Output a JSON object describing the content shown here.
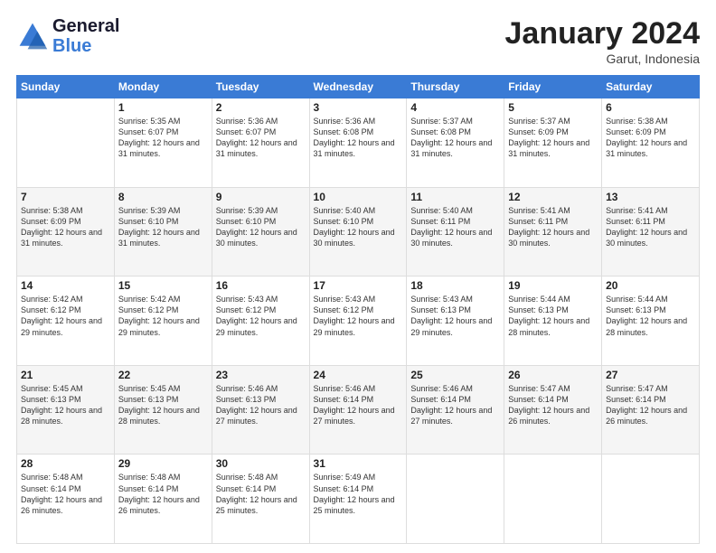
{
  "header": {
    "logo_line1": "General",
    "logo_line2": "Blue",
    "month": "January 2024",
    "location": "Garut, Indonesia"
  },
  "days": [
    "Sunday",
    "Monday",
    "Tuesday",
    "Wednesday",
    "Thursday",
    "Friday",
    "Saturday"
  ],
  "weeks": [
    [
      {
        "num": "",
        "sunrise": "",
        "sunset": "",
        "daylight": ""
      },
      {
        "num": "1",
        "sunrise": "Sunrise: 5:35 AM",
        "sunset": "Sunset: 6:07 PM",
        "daylight": "Daylight: 12 hours and 31 minutes."
      },
      {
        "num": "2",
        "sunrise": "Sunrise: 5:36 AM",
        "sunset": "Sunset: 6:07 PM",
        "daylight": "Daylight: 12 hours and 31 minutes."
      },
      {
        "num": "3",
        "sunrise": "Sunrise: 5:36 AM",
        "sunset": "Sunset: 6:08 PM",
        "daylight": "Daylight: 12 hours and 31 minutes."
      },
      {
        "num": "4",
        "sunrise": "Sunrise: 5:37 AM",
        "sunset": "Sunset: 6:08 PM",
        "daylight": "Daylight: 12 hours and 31 minutes."
      },
      {
        "num": "5",
        "sunrise": "Sunrise: 5:37 AM",
        "sunset": "Sunset: 6:09 PM",
        "daylight": "Daylight: 12 hours and 31 minutes."
      },
      {
        "num": "6",
        "sunrise": "Sunrise: 5:38 AM",
        "sunset": "Sunset: 6:09 PM",
        "daylight": "Daylight: 12 hours and 31 minutes."
      }
    ],
    [
      {
        "num": "7",
        "sunrise": "Sunrise: 5:38 AM",
        "sunset": "Sunset: 6:09 PM",
        "daylight": "Daylight: 12 hours and 31 minutes."
      },
      {
        "num": "8",
        "sunrise": "Sunrise: 5:39 AM",
        "sunset": "Sunset: 6:10 PM",
        "daylight": "Daylight: 12 hours and 31 minutes."
      },
      {
        "num": "9",
        "sunrise": "Sunrise: 5:39 AM",
        "sunset": "Sunset: 6:10 PM",
        "daylight": "Daylight: 12 hours and 30 minutes."
      },
      {
        "num": "10",
        "sunrise": "Sunrise: 5:40 AM",
        "sunset": "Sunset: 6:10 PM",
        "daylight": "Daylight: 12 hours and 30 minutes."
      },
      {
        "num": "11",
        "sunrise": "Sunrise: 5:40 AM",
        "sunset": "Sunset: 6:11 PM",
        "daylight": "Daylight: 12 hours and 30 minutes."
      },
      {
        "num": "12",
        "sunrise": "Sunrise: 5:41 AM",
        "sunset": "Sunset: 6:11 PM",
        "daylight": "Daylight: 12 hours and 30 minutes."
      },
      {
        "num": "13",
        "sunrise": "Sunrise: 5:41 AM",
        "sunset": "Sunset: 6:11 PM",
        "daylight": "Daylight: 12 hours and 30 minutes."
      }
    ],
    [
      {
        "num": "14",
        "sunrise": "Sunrise: 5:42 AM",
        "sunset": "Sunset: 6:12 PM",
        "daylight": "Daylight: 12 hours and 29 minutes."
      },
      {
        "num": "15",
        "sunrise": "Sunrise: 5:42 AM",
        "sunset": "Sunset: 6:12 PM",
        "daylight": "Daylight: 12 hours and 29 minutes."
      },
      {
        "num": "16",
        "sunrise": "Sunrise: 5:43 AM",
        "sunset": "Sunset: 6:12 PM",
        "daylight": "Daylight: 12 hours and 29 minutes."
      },
      {
        "num": "17",
        "sunrise": "Sunrise: 5:43 AM",
        "sunset": "Sunset: 6:12 PM",
        "daylight": "Daylight: 12 hours and 29 minutes."
      },
      {
        "num": "18",
        "sunrise": "Sunrise: 5:43 AM",
        "sunset": "Sunset: 6:13 PM",
        "daylight": "Daylight: 12 hours and 29 minutes."
      },
      {
        "num": "19",
        "sunrise": "Sunrise: 5:44 AM",
        "sunset": "Sunset: 6:13 PM",
        "daylight": "Daylight: 12 hours and 28 minutes."
      },
      {
        "num": "20",
        "sunrise": "Sunrise: 5:44 AM",
        "sunset": "Sunset: 6:13 PM",
        "daylight": "Daylight: 12 hours and 28 minutes."
      }
    ],
    [
      {
        "num": "21",
        "sunrise": "Sunrise: 5:45 AM",
        "sunset": "Sunset: 6:13 PM",
        "daylight": "Daylight: 12 hours and 28 minutes."
      },
      {
        "num": "22",
        "sunrise": "Sunrise: 5:45 AM",
        "sunset": "Sunset: 6:13 PM",
        "daylight": "Daylight: 12 hours and 28 minutes."
      },
      {
        "num": "23",
        "sunrise": "Sunrise: 5:46 AM",
        "sunset": "Sunset: 6:13 PM",
        "daylight": "Daylight: 12 hours and 27 minutes."
      },
      {
        "num": "24",
        "sunrise": "Sunrise: 5:46 AM",
        "sunset": "Sunset: 6:14 PM",
        "daylight": "Daylight: 12 hours and 27 minutes."
      },
      {
        "num": "25",
        "sunrise": "Sunrise: 5:46 AM",
        "sunset": "Sunset: 6:14 PM",
        "daylight": "Daylight: 12 hours and 27 minutes."
      },
      {
        "num": "26",
        "sunrise": "Sunrise: 5:47 AM",
        "sunset": "Sunset: 6:14 PM",
        "daylight": "Daylight: 12 hours and 26 minutes."
      },
      {
        "num": "27",
        "sunrise": "Sunrise: 5:47 AM",
        "sunset": "Sunset: 6:14 PM",
        "daylight": "Daylight: 12 hours and 26 minutes."
      }
    ],
    [
      {
        "num": "28",
        "sunrise": "Sunrise: 5:48 AM",
        "sunset": "Sunset: 6:14 PM",
        "daylight": "Daylight: 12 hours and 26 minutes."
      },
      {
        "num": "29",
        "sunrise": "Sunrise: 5:48 AM",
        "sunset": "Sunset: 6:14 PM",
        "daylight": "Daylight: 12 hours and 26 minutes."
      },
      {
        "num": "30",
        "sunrise": "Sunrise: 5:48 AM",
        "sunset": "Sunset: 6:14 PM",
        "daylight": "Daylight: 12 hours and 25 minutes."
      },
      {
        "num": "31",
        "sunrise": "Sunrise: 5:49 AM",
        "sunset": "Sunset: 6:14 PM",
        "daylight": "Daylight: 12 hours and 25 minutes."
      },
      {
        "num": "",
        "sunrise": "",
        "sunset": "",
        "daylight": ""
      },
      {
        "num": "",
        "sunrise": "",
        "sunset": "",
        "daylight": ""
      },
      {
        "num": "",
        "sunrise": "",
        "sunset": "",
        "daylight": ""
      }
    ]
  ]
}
